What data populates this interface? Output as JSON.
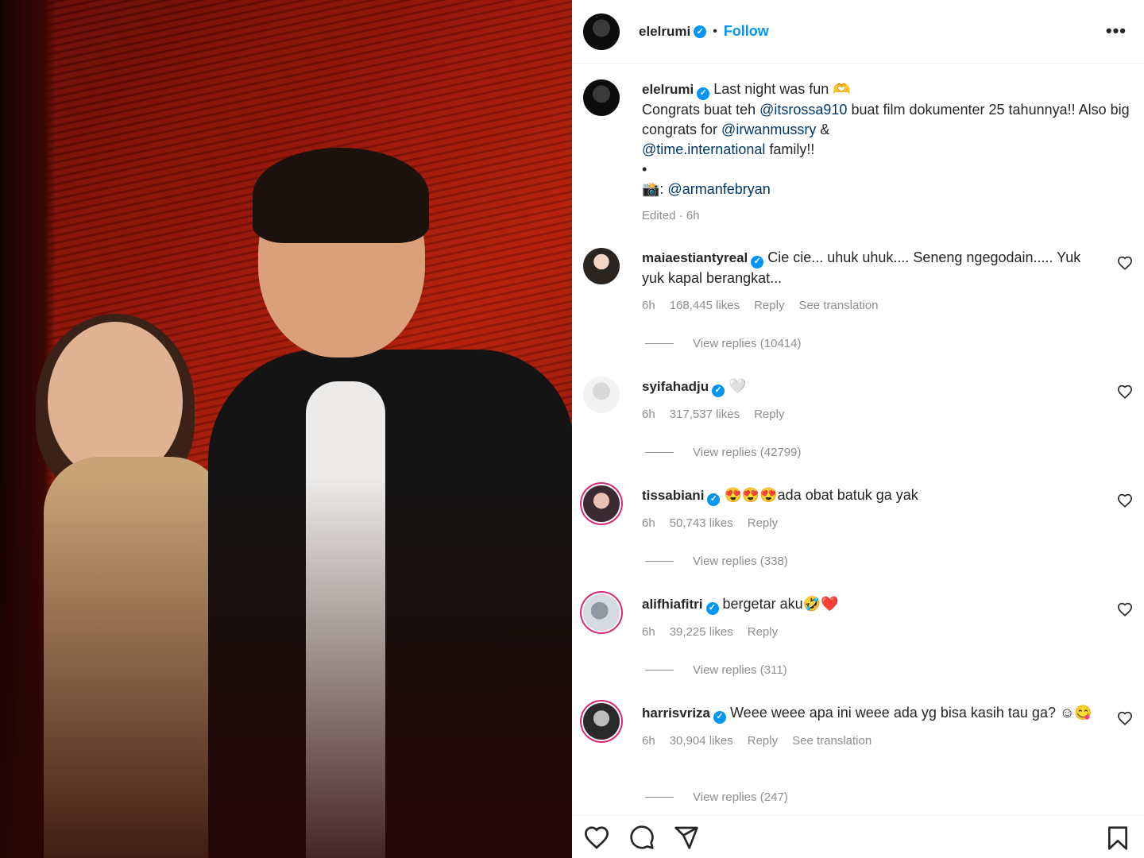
{
  "post": {
    "owner": "elelrumi",
    "follow_label": "Follow",
    "more_label": "•••",
    "caption_first_line": "Last night was fun 🫶",
    "caption_line2_a": "Congrats buat teh ",
    "mention_rossa": "@itsrossa910",
    "caption_line2_b": " buat film dokumenter 25 tahunnya!! Also big congrats for ",
    "mention_irwan": "@irwanmussry",
    "caption_amp": " & ",
    "mention_time": "@time.international",
    "caption_family": " family!!",
    "caption_bullet": "•",
    "camera_prefix": "📸: ",
    "mention_arman": "@armanfebryan",
    "caption_meta": "Edited · 6h"
  },
  "comments": [
    {
      "user": "maiaestiantyreal",
      "text": "Cie cie... uhuk uhuk.... Seneng ngegodain..... Yuk yuk kapal berangkat...",
      "time": "6h",
      "likes": "168,445 likes",
      "reply": "Reply",
      "translation": "See translation",
      "view_replies": "View replies (10414)"
    },
    {
      "user": "syifahadju",
      "text": "🤍",
      "time": "6h",
      "likes": "317,537 likes",
      "reply": "Reply",
      "view_replies": "View replies (42799)"
    },
    {
      "user": "tissabiani",
      "text": "😍😍😍ada obat batuk ga yak",
      "time": "6h",
      "likes": "50,743 likes",
      "reply": "Reply",
      "view_replies": "View replies (338)"
    },
    {
      "user": "alifhiafitri",
      "text": "bergetar aku🤣❤️",
      "time": "6h",
      "likes": "39,225 likes",
      "reply": "Reply",
      "view_replies": "View replies (311)"
    },
    {
      "user": "harrisvriza",
      "text": "Weee weee apa ini weee ada yg bisa kasih tau ga? ☺😋",
      "time": "6h",
      "likes": "30,904 likes",
      "reply": "Reply",
      "translation": "See translation",
      "view_replies": "View replies (247)"
    }
  ],
  "colors": {
    "link": "#00376b",
    "follow": "#0095f6",
    "verified": "#0095f6",
    "meta": "#8e8e8e"
  },
  "icons": [
    "heart-icon",
    "comment-icon",
    "share-icon",
    "bookmark-icon",
    "verified-icon",
    "more-icon"
  ]
}
